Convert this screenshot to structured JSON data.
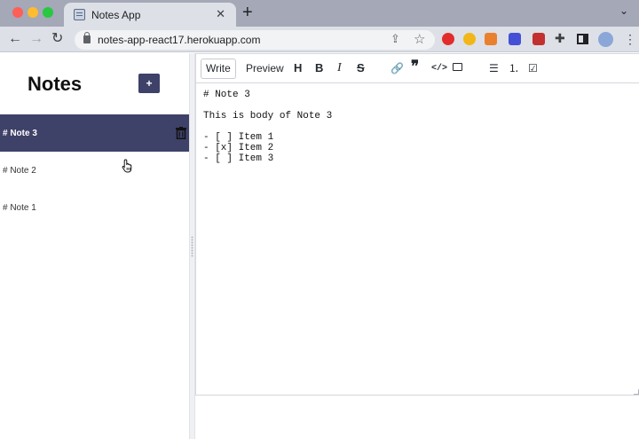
{
  "browser": {
    "tab_title": "Notes App",
    "tab_close": "✕",
    "new_tab": "+",
    "tabs_menu": "⌄",
    "nav_back": "←",
    "nav_forward": "→",
    "nav_reload": "↻",
    "url": "notes-app-react17.herokuapp.com",
    "share": "⇪",
    "star": "☆",
    "puzzle": "✚",
    "menu": "⋮"
  },
  "sidebar": {
    "title": "Notes",
    "add_label": "+",
    "notes": [
      {
        "label": "# Note 3",
        "active": true
      },
      {
        "label": "# Note 2",
        "active": false
      },
      {
        "label": "# Note 1",
        "active": false
      }
    ]
  },
  "editor": {
    "tabs": {
      "write": "Write",
      "preview": "Preview"
    },
    "toolbar": {
      "heading": "H",
      "bold": "B",
      "italic": "I",
      "strike": "S",
      "link": "🔗",
      "quote": "❞",
      "code": "</>",
      "unordered_list": "☰",
      "ordered_list": "⒈",
      "task_list": "☑"
    },
    "content": "# Note 3\n\nThis is body of Note 3\n\n- [ ] Item 1\n- [x] Item 2\n- [ ] Item 3"
  },
  "colors": {
    "accent": "#3e4168",
    "tab_strip": "#a4a8b7",
    "toolbar_bg": "#dde0e6"
  }
}
